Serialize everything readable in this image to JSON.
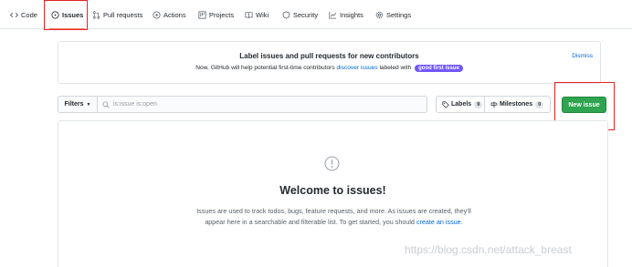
{
  "nav": {
    "tabs": [
      {
        "label": "Code",
        "icon": "code-icon"
      },
      {
        "label": "Issues",
        "icon": "issue-opened-icon",
        "selected": true
      },
      {
        "label": "Pull requests",
        "icon": "git-pull-request-icon"
      },
      {
        "label": "Actions",
        "icon": "play-icon"
      },
      {
        "label": "Projects",
        "icon": "project-icon"
      },
      {
        "label": "Wiki",
        "icon": "book-icon"
      },
      {
        "label": "Security",
        "icon": "shield-icon"
      },
      {
        "label": "Insights",
        "icon": "graph-icon"
      },
      {
        "label": "Settings",
        "icon": "gear-icon"
      }
    ]
  },
  "banner": {
    "title": "Label issues and pull requests for new contributors",
    "text_before": "Now, GitHub will help potential first-time contributors",
    "link": "discover issues",
    "text_after": "labeled with",
    "label": "good first issue",
    "dismiss": "Dismiss"
  },
  "filters": {
    "button_label": "Filters",
    "search_value": "is:issue is:open"
  },
  "labels": {
    "label": "Labels",
    "count": "9"
  },
  "milestones": {
    "label": "Milestones",
    "count": "0"
  },
  "new_issue": {
    "label": "New issue"
  },
  "blankslate": {
    "title": "Welcome to issues!",
    "text_line1": "Issues are used to track todos, bugs, feature requests, and more. As issues are created, they'll",
    "text_line2": "appear here in a searchable and filterable list. To get started, you should",
    "link": "create an issue",
    "text_end": "."
  },
  "watermark": "https://blog.csdn.net/attack_breast",
  "colors": {
    "accent_underline": "#f9826c",
    "link": "#0366d6",
    "primary_button": "#2ea44f",
    "label_purple": "#7057ff",
    "annotation_red": "#e62222"
  }
}
